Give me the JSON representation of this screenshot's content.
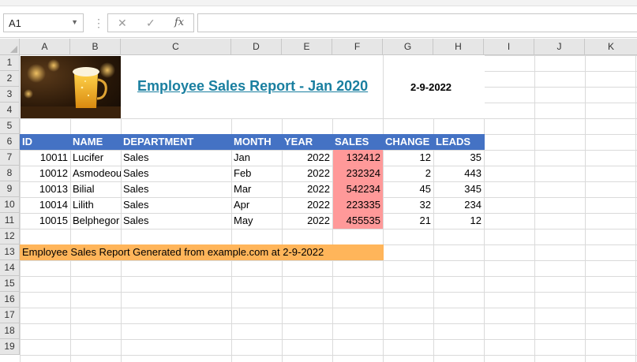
{
  "formula_bar": {
    "name_box": "A1",
    "cancel_icon": "✕",
    "enter_icon": "✓",
    "fx_label": "fx",
    "formula": ""
  },
  "columns": [
    "A",
    "B",
    "C",
    "D",
    "E",
    "F",
    "G",
    "H",
    "I",
    "J",
    "K"
  ],
  "rows": [
    "1",
    "2",
    "3",
    "4",
    "5",
    "6",
    "7",
    "8",
    "9",
    "10",
    "11",
    "12",
    "13",
    "14",
    "15",
    "16",
    "17",
    "18",
    "19"
  ],
  "report": {
    "title": "Employee Sales Report - Jan 2020",
    "date": "2-9-2022",
    "image_alt": "beer-glass-image"
  },
  "table": {
    "headers": [
      "ID",
      "NAME",
      "DEPARTMENT",
      "MONTH",
      "YEAR",
      "SALES",
      "CHANGE",
      "LEADS"
    ],
    "rows": [
      {
        "id": "10011",
        "name": "Lucifer",
        "department": "Sales",
        "month": "Jan",
        "year": "2022",
        "sales": "132412",
        "change": "12",
        "leads": "35"
      },
      {
        "id": "10012",
        "name": "Asmodeous",
        "department": "Sales",
        "month": "Feb",
        "year": "2022",
        "sales": "232324",
        "change": "2",
        "leads": "443"
      },
      {
        "id": "10013",
        "name": "Bilial",
        "department": "Sales",
        "month": "Mar",
        "year": "2022",
        "sales": "542234",
        "change": "45",
        "leads": "345"
      },
      {
        "id": "10014",
        "name": "Lilith",
        "department": "Sales",
        "month": "Apr",
        "year": "2022",
        "sales": "223335",
        "change": "32",
        "leads": "234"
      },
      {
        "id": "10015",
        "name": "Belphegor",
        "department": "Sales",
        "month": "May",
        "year": "2022",
        "sales": "455535",
        "change": "21",
        "leads": "12"
      }
    ]
  },
  "footer_note": "Employee Sales Report Generated from example.com at 2-9-2022",
  "colors": {
    "header_fill": "#4472c4",
    "sales_fill": "#ff9999",
    "footer_fill": "#ffb55a",
    "title_color": "#1a7fa0"
  }
}
